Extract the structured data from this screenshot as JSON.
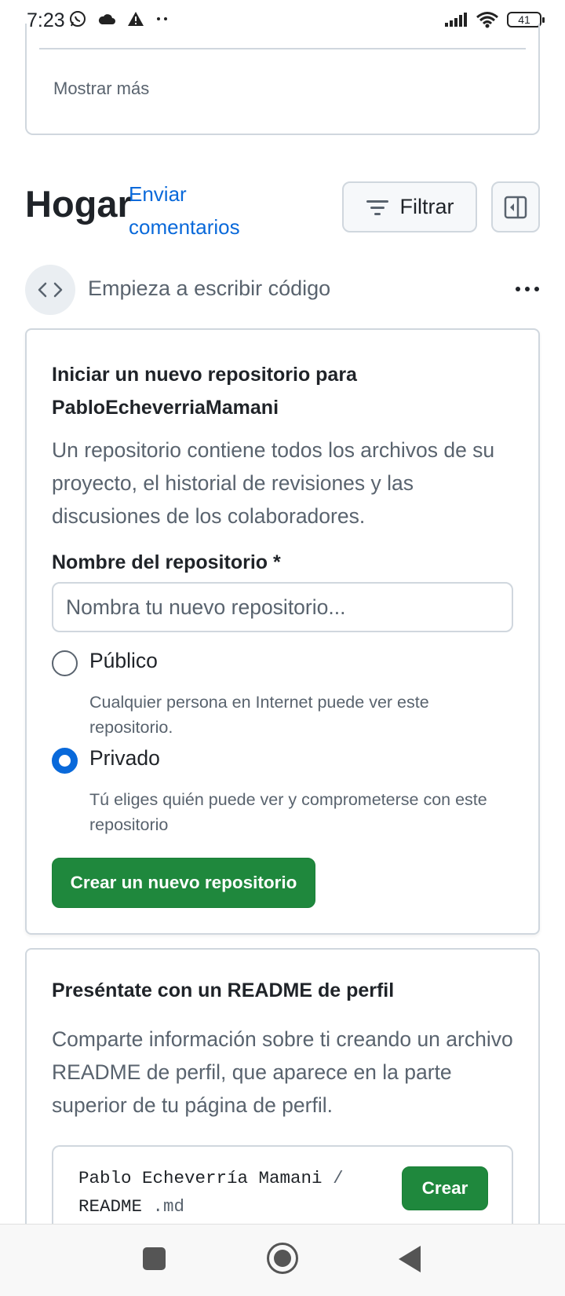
{
  "status_bar": {
    "time": "7:23",
    "icons_left": [
      "whatsapp-icon",
      "cloud-icon",
      "warning-icon",
      "dots-icon"
    ],
    "icons_right": [
      "signal-icon",
      "wifi-icon",
      "battery-icon"
    ],
    "battery_level": "41"
  },
  "previous_section": {
    "show_more_label": "Mostrar más"
  },
  "header": {
    "title": "Hogar",
    "feedback_link": "Enviar comentarios",
    "filter_label": "Filtrar"
  },
  "start_coding": {
    "label": "Empieza a escribir código"
  },
  "new_repo": {
    "title": "Iniciar un nuevo repositorio para PabloEcheverriaMamani",
    "description": "Un repositorio contiene todos los archivos de su proyecto, el historial de revisiones y las discusiones de los colaboradores.",
    "name_label": "Nombre del repositorio *",
    "name_placeholder": "Nombra tu nuevo repositorio...",
    "visibility_options": [
      {
        "label": "Público",
        "description": "Cualquier persona en Internet puede ver este repositorio.",
        "selected": false
      },
      {
        "label": "Privado",
        "description": "Tú eliges quién puede ver y comprometerse con este repositorio",
        "selected": true
      }
    ],
    "create_button": "Crear un nuevo repositorio"
  },
  "readme": {
    "title": "Preséntate con un README de perfil",
    "description": "Comparte información sobre ti creando un archivo README de perfil, que aparece en la parte superior de tu página de perfil.",
    "path_owner": "Pablo Echeverría Mamani",
    "path_separator": "/",
    "path_file": "README",
    "path_ext": ".md",
    "create_button": "Crear"
  },
  "colors": {
    "link": "#0969da",
    "primary_button": "#1f883d",
    "muted_text": "#59636e",
    "border": "#d0d7de"
  }
}
